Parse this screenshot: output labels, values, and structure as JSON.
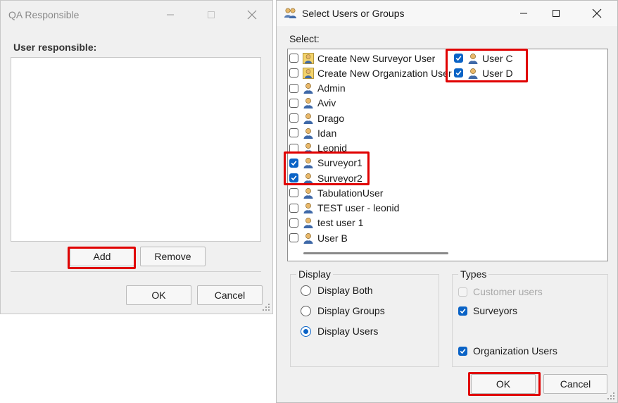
{
  "qa_window": {
    "title": "QA Responsible",
    "label": "User responsible:",
    "add_label": "Add",
    "remove_label": "Remove",
    "ok_label": "OK",
    "cancel_label": "Cancel"
  },
  "select_dialog": {
    "title": "Select Users or Groups",
    "select_label": "Select:",
    "left_items": [
      {
        "label": "Create New Surveyor User",
        "checked": false,
        "icon": "group-user-icon"
      },
      {
        "label": "Create New Organization User",
        "checked": false,
        "icon": "group-user-icon"
      },
      {
        "label": "Admin",
        "checked": false,
        "icon": "user-icon"
      },
      {
        "label": "Aviv",
        "checked": false,
        "icon": "user-icon"
      },
      {
        "label": "Drago",
        "checked": false,
        "icon": "user-icon"
      },
      {
        "label": "Idan",
        "checked": false,
        "icon": "user-icon"
      },
      {
        "label": "Leonid",
        "checked": false,
        "icon": "user-icon"
      },
      {
        "label": "Surveyor1",
        "checked": true,
        "icon": "user-icon"
      },
      {
        "label": "Surveyor2",
        "checked": true,
        "icon": "user-icon"
      },
      {
        "label": "TabulationUser",
        "checked": false,
        "icon": "user-icon"
      },
      {
        "label": "TEST user - leonid",
        "checked": false,
        "icon": "user-icon"
      },
      {
        "label": "test user 1",
        "checked": false,
        "icon": "user-icon"
      },
      {
        "label": "User B",
        "checked": false,
        "icon": "user-icon"
      }
    ],
    "right_items": [
      {
        "label": "User C",
        "checked": true,
        "icon": "user-icon"
      },
      {
        "label": "User D",
        "checked": true,
        "icon": "user-icon"
      }
    ],
    "display_group": {
      "title": "Display",
      "options": [
        {
          "label": "Display Both",
          "selected": false
        },
        {
          "label": "Display Groups",
          "selected": false
        },
        {
          "label": "Display Users",
          "selected": true
        }
      ]
    },
    "types_group": {
      "title": "Types",
      "options": [
        {
          "label": "Customer users",
          "checked": false,
          "disabled": true
        },
        {
          "label": "Surveyors",
          "checked": true,
          "disabled": false
        },
        {
          "label": "Organization Users",
          "checked": true,
          "disabled": false
        }
      ]
    },
    "ok_label": "OK",
    "cancel_label": "Cancel"
  },
  "colors": {
    "highlight": "#e00000",
    "accent": "#0a63c6"
  }
}
